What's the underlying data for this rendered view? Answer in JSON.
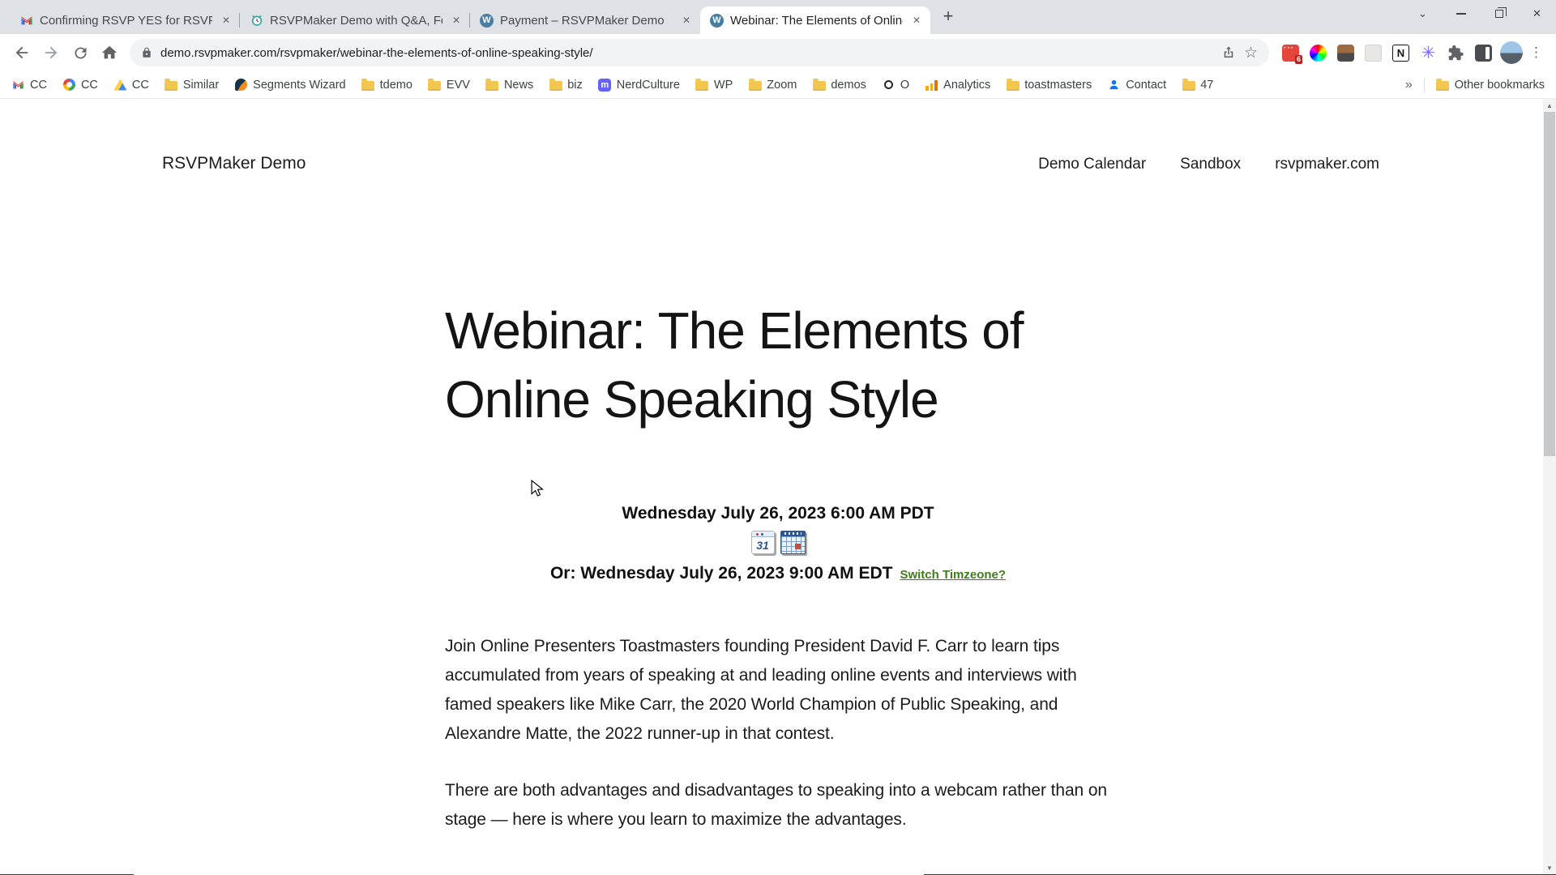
{
  "colors": {
    "link_green": "#3f7d1b",
    "wordpress_blue": "#4a7d9f",
    "mastodon_purple": "#6364ff",
    "folder_yellow": "#f3c64f",
    "badge_red": "#b3261e",
    "tabstrip_gray": "#dee1e6"
  },
  "browser": {
    "tabs": [
      {
        "title": "Confirming RSVP YES for RSVPM",
        "favicon": "gmail-icon"
      },
      {
        "title": "RSVPMaker Demo with Q&A, Fea",
        "favicon": "alarm-clock-icon"
      },
      {
        "title": "Payment – RSVPMaker Demo",
        "favicon": "wordpress-icon"
      },
      {
        "title": "Webinar: The Elements of Online",
        "favicon": "wordpress-icon"
      }
    ],
    "active_tab_index": 3,
    "url": "demo.rsvpmaker.com/rsvpmaker/webinar-the-elements-of-online-speaking-style/",
    "extension_badge_count": "6",
    "bookmarks": [
      {
        "label": "CC",
        "icon": "gmail-icon"
      },
      {
        "label": "CC",
        "icon": "google-icon"
      },
      {
        "label": "CC",
        "icon": "drive-icon"
      },
      {
        "label": "Similar",
        "icon": "folder-icon"
      },
      {
        "label": "Segments Wizard",
        "icon": "segments-icon"
      },
      {
        "label": "tdemo",
        "icon": "folder-icon"
      },
      {
        "label": "EVV",
        "icon": "folder-icon"
      },
      {
        "label": "News",
        "icon": "folder-icon"
      },
      {
        "label": "biz",
        "icon": "folder-icon"
      },
      {
        "label": "NerdCulture",
        "icon": "mastodon-icon"
      },
      {
        "label": "WP",
        "icon": "folder-icon"
      },
      {
        "label": "Zoom",
        "icon": "folder-icon"
      },
      {
        "label": "demos",
        "icon": "folder-icon"
      },
      {
        "label": "O",
        "icon": "ring-icon"
      },
      {
        "label": "Analytics",
        "icon": "analytics-icon"
      },
      {
        "label": "toastmasters",
        "icon": "folder-icon"
      },
      {
        "label": "Contact",
        "icon": "person-icon"
      },
      {
        "label": "47",
        "icon": "folder-icon"
      }
    ],
    "bookmarks_overflow": "»",
    "other_bookmarks_label": "Other bookmarks"
  },
  "page": {
    "site_title": "RSVPMaker Demo",
    "nav": [
      "Demo Calendar",
      "Sandbox",
      "rsvpmaker.com"
    ],
    "heading": "Webinar: The Elements of Online Speaking Style",
    "datetime_primary": "Wednesday July 26, 2023 6:00 AM PDT",
    "datetime_secondary": "Or: Wednesday July 26, 2023 9:00 AM EDT",
    "switch_timezone_label": "Switch Timzeone?",
    "calendar_icon_date": "31",
    "paragraphs": {
      "p1": "Join Online Presenters Toastmasters founding President David F. Carr to learn tips accumulated from years of speaking at and leading online events and interviews with famed speakers like Mike Carr, the 2020 World Champion of Public Speaking, and Alexandre Matte, the 2022 runner-up in that contest.",
      "p2": "There are both advantages and disadvantages to speaking into a webcam rather than on stage — here is where you learn to maximize the advantages."
    }
  }
}
